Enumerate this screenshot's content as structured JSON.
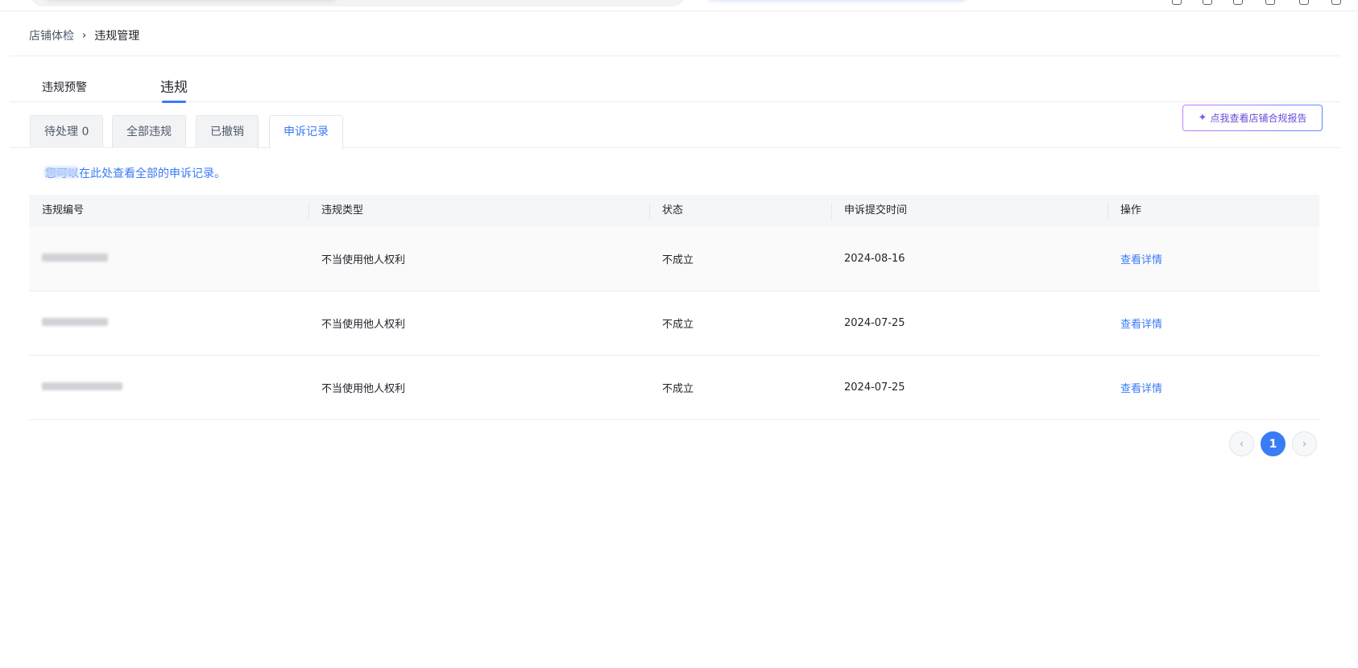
{
  "breadcrumb": {
    "parent": "店铺体检",
    "separator": "›",
    "current": "违规管理"
  },
  "main_tabs": [
    {
      "label": "违规预警"
    },
    {
      "label": "违规",
      "active": true
    }
  ],
  "sub_tabs": [
    {
      "label": "待处理 0"
    },
    {
      "label": "全部违规"
    },
    {
      "label": "已撤销"
    },
    {
      "label": "申诉记录",
      "active": true
    }
  ],
  "report_button": {
    "label": "点我查看店铺合规报告",
    "icon": "sparkle-icon"
  },
  "notice": "您可以在此处查看全部的申诉记录。",
  "table": {
    "columns": [
      "违规编号",
      "违规类型",
      "状态",
      "申诉提交时间",
      "操作"
    ],
    "rows": [
      {
        "type": "不当使用他人权利",
        "status": "不成立",
        "submitted": "2024-08-16",
        "action": "查看详情"
      },
      {
        "type": "不当使用他人权利",
        "status": "不成立",
        "submitted": "2024-07-25",
        "action": "查看详情"
      },
      {
        "type": "不当使用他人权利",
        "status": "不成立",
        "submitted": "2024-07-25",
        "action": "查看详情"
      }
    ]
  },
  "pagination": {
    "prev": "‹",
    "current": "1",
    "next": "›"
  },
  "colors": {
    "accent": "#3a7bf6",
    "header_bg": "#f5f6f7",
    "border": "#e9ecf0"
  }
}
